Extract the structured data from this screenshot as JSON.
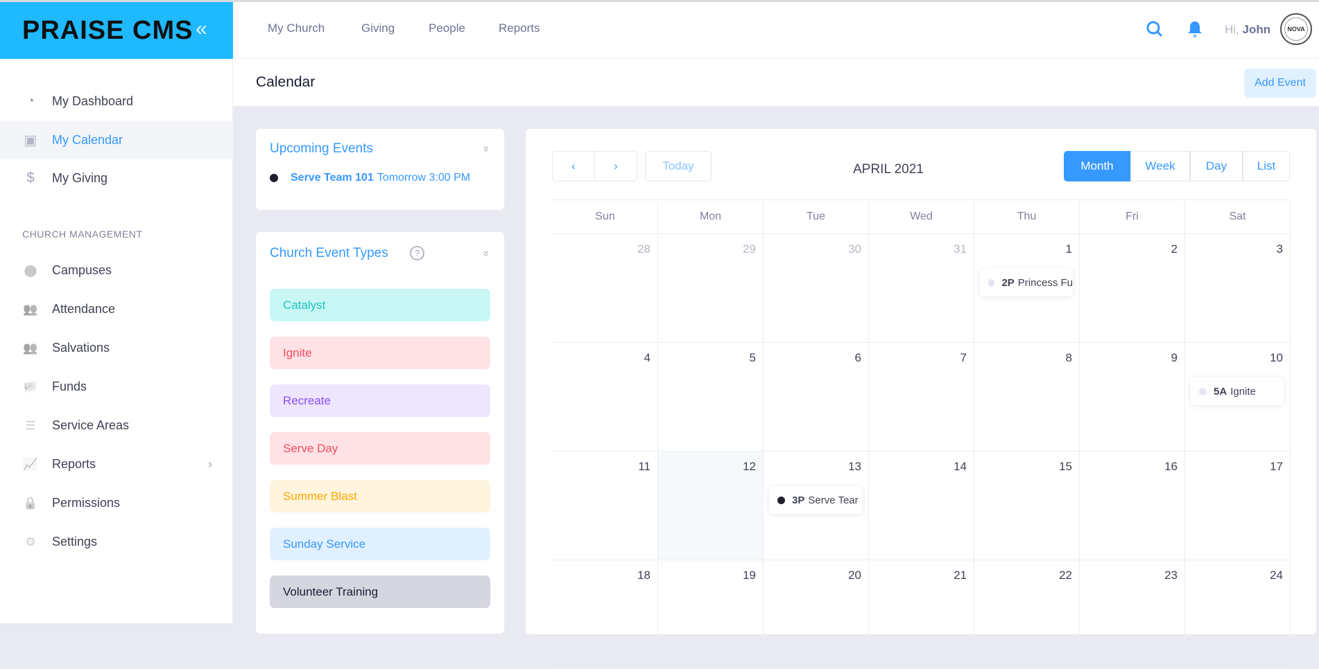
{
  "app": {
    "logo": "PRAISE CMS",
    "collapse_icon": "«"
  },
  "topnav": [
    {
      "label": "My Church"
    },
    {
      "label": "Giving"
    },
    {
      "label": "People"
    },
    {
      "label": "Reports"
    }
  ],
  "user": {
    "greeting": "Hi,",
    "name": "John",
    "avatar_text": "NOVA"
  },
  "sidebar": {
    "items": [
      {
        "label": "My Dashboard",
        "icon": "◔"
      },
      {
        "label": "My Calendar",
        "icon": "▣"
      },
      {
        "label": "My Giving",
        "icon": "$"
      }
    ],
    "section": "CHURCH MANAGEMENT",
    "mgmt": [
      {
        "label": "Campuses",
        "icon": "⬤"
      },
      {
        "label": "Attendance",
        "icon": "👥"
      },
      {
        "label": "Salvations",
        "icon": "👥"
      },
      {
        "label": "Funds",
        "icon": "🐖"
      },
      {
        "label": "Service Areas",
        "icon": "☰"
      },
      {
        "label": "Reports",
        "icon": "📈"
      },
      {
        "label": "Permissions",
        "icon": "🔒"
      },
      {
        "label": "Settings",
        "icon": "⚙"
      }
    ],
    "reports_chevron": "›"
  },
  "page": {
    "title": "Calendar",
    "add_event": "Add Event"
  },
  "upcoming": {
    "title": "Upcoming Events",
    "events": [
      {
        "name": "Serve Team 101",
        "when": "Tomorrow 3:00 PM",
        "color": "#1e1e2d"
      }
    ]
  },
  "event_types": {
    "title": "Church Event Types",
    "help": "?",
    "items": [
      {
        "label": "Catalyst",
        "bg": "#c9f7f5",
        "fg": "#1bc5bd"
      },
      {
        "label": "Ignite",
        "bg": "#ffe2e5",
        "fg": "#f64e60"
      },
      {
        "label": "Recreate",
        "bg": "#eee5ff",
        "fg": "#8950fc"
      },
      {
        "label": "Serve Day",
        "bg": "#ffe2e5",
        "fg": "#f64e60"
      },
      {
        "label": "Summer Blast",
        "bg": "#fff4de",
        "fg": "#ffa800"
      },
      {
        "label": "Sunday Service",
        "bg": "#e1f0ff",
        "fg": "#3699ff"
      },
      {
        "label": "Volunteer Training",
        "bg": "#d6d6e0",
        "fg": "#181c32"
      }
    ]
  },
  "calendar": {
    "title": "APRIL 2021",
    "prev": "‹",
    "next": "›",
    "today": "Today",
    "views": [
      {
        "label": "Month",
        "active": true
      },
      {
        "label": "Week"
      },
      {
        "label": "Day"
      },
      {
        "label": "List"
      }
    ],
    "weekdays": [
      "Sun",
      "Mon",
      "Tue",
      "Wed",
      "Thu",
      "Fri",
      "Sat"
    ],
    "weeks": [
      [
        {
          "n": "28",
          "m": true
        },
        {
          "n": "29",
          "m": true
        },
        {
          "n": "30",
          "m": true
        },
        {
          "n": "31",
          "m": true
        },
        {
          "n": "1",
          "ev": {
            "time": "2P",
            "title": "Princess Fu",
            "color": "#e4e6ef"
          }
        },
        {
          "n": "2"
        },
        {
          "n": "3"
        }
      ],
      [
        {
          "n": "4"
        },
        {
          "n": "5"
        },
        {
          "n": "6"
        },
        {
          "n": "7"
        },
        {
          "n": "8"
        },
        {
          "n": "9"
        },
        {
          "n": "10",
          "ev": {
            "time": "5A",
            "title": "Ignite",
            "color": "#e4e6ef"
          }
        }
      ],
      [
        {
          "n": "11"
        },
        {
          "n": "12",
          "today": true
        },
        {
          "n": "13",
          "ev": {
            "time": "3P",
            "title": "Serve Tear",
            "color": "#1e1e2d"
          }
        },
        {
          "n": "14"
        },
        {
          "n": "15"
        },
        {
          "n": "16"
        },
        {
          "n": "17"
        }
      ],
      [
        {
          "n": "18"
        },
        {
          "n": "19"
        },
        {
          "n": "20"
        },
        {
          "n": "21"
        },
        {
          "n": "22"
        },
        {
          "n": "23"
        },
        {
          "n": "24"
        }
      ]
    ]
  }
}
